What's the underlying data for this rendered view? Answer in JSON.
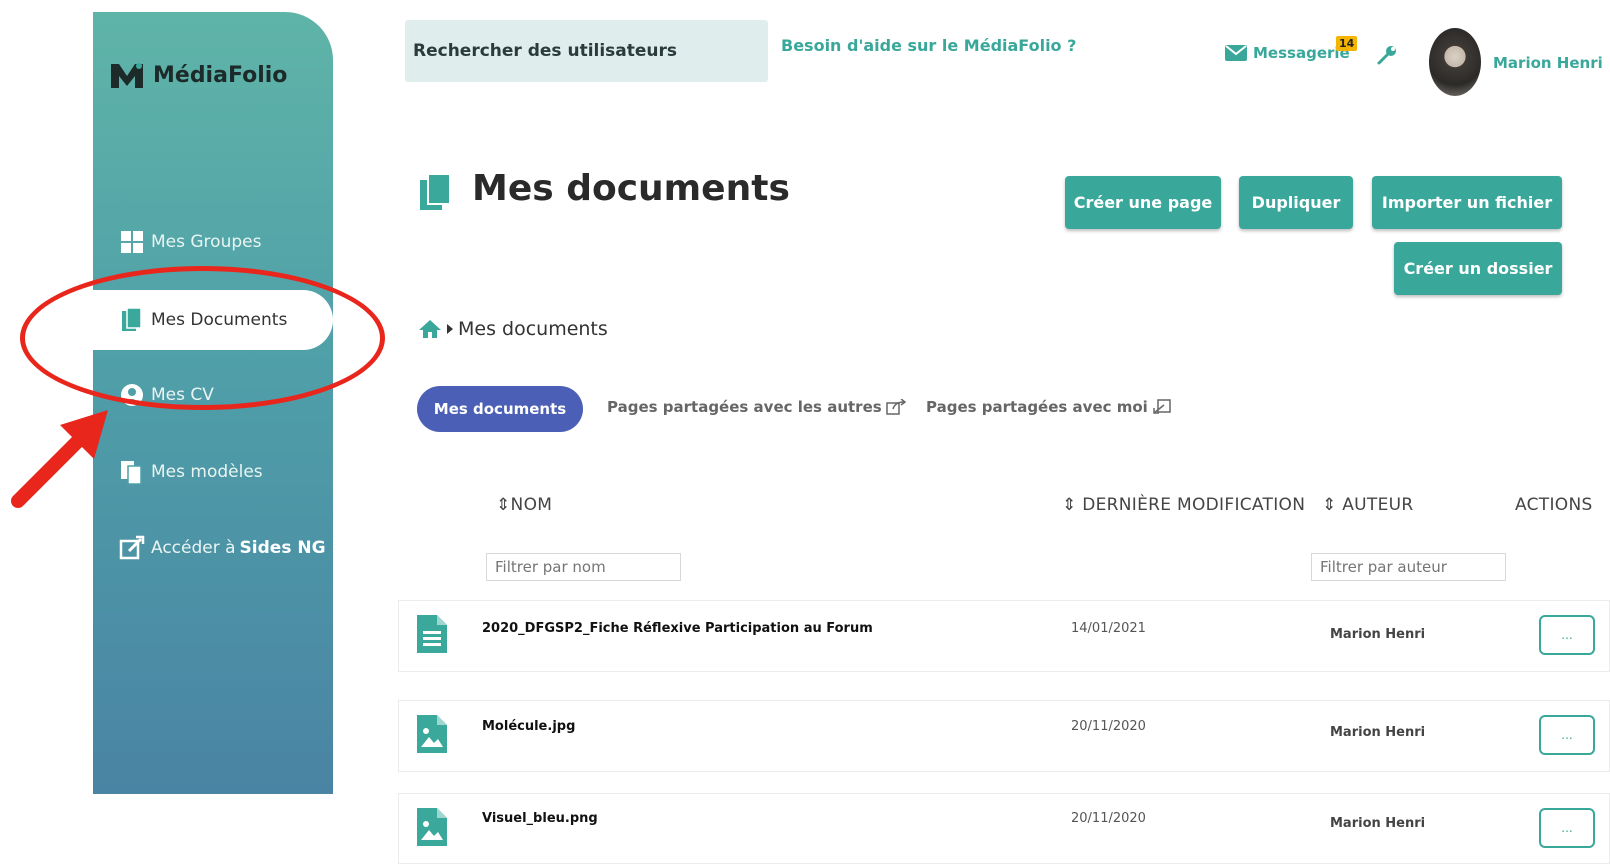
{
  "brand": {
    "name": "MédiaFolio",
    "logo_icon": "m-logo-icon"
  },
  "sidebar": {
    "items": [
      {
        "label": "Mes Groupes",
        "icon": "grid-icon"
      },
      {
        "label": "Mes Documents",
        "icon": "documents-icon",
        "active": true
      },
      {
        "label": "Mes CV",
        "icon": "user-icon"
      },
      {
        "label": "Mes modèles",
        "icon": "copy-icon"
      },
      {
        "label": "Accéder à",
        "label_bold": "Sides NG",
        "icon": "external-edit-icon"
      }
    ]
  },
  "header": {
    "search_label": "Rechercher des utilisateurs",
    "help_link": "Besoin d'aide sur le MédiaFolio ?",
    "messages_label": "Messagerie",
    "messages_badge": "14",
    "user_name": "Marion Henri"
  },
  "page": {
    "title": "Mes documents",
    "buttons": {
      "create_page": "Créer une page",
      "duplicate": "Dupliquer",
      "import_file": "Importer un fichier",
      "create_folder": "Créer un dossier"
    },
    "breadcrumb": "Mes documents"
  },
  "tabs": {
    "mine": "Mes documents",
    "shared_with_others": "Pages partagées avec les autres",
    "shared_with_me": "Pages partagées avec moi"
  },
  "table": {
    "headers": {
      "name": "NOM",
      "modified": "DERNIÈRE MODIFICATION",
      "author": "AUTEUR",
      "actions": "ACTIONS"
    },
    "filters": {
      "name_placeholder": "Filtrer par nom",
      "author_placeholder": "Filtrer par auteur"
    },
    "rows": [
      {
        "name": "2020_DFGSP2_Fiche Réflexive Participation au Forum",
        "date": "14/01/2021",
        "author": "Marion Henri",
        "action": "...",
        "icon": "document-file-icon"
      },
      {
        "name": "Molécule.jpg",
        "date": "20/11/2020",
        "author": "Marion Henri",
        "action": "...",
        "icon": "image-file-icon"
      },
      {
        "name": "Visuel_bleu.png",
        "date": "20/11/2020",
        "author": "Marion Henri",
        "action": "...",
        "icon": "image-file-icon"
      }
    ]
  },
  "colors": {
    "accent": "#39a89b",
    "tab_active": "#4a5fb5",
    "annotation": "#e8261c",
    "badge": "#f4b400"
  }
}
